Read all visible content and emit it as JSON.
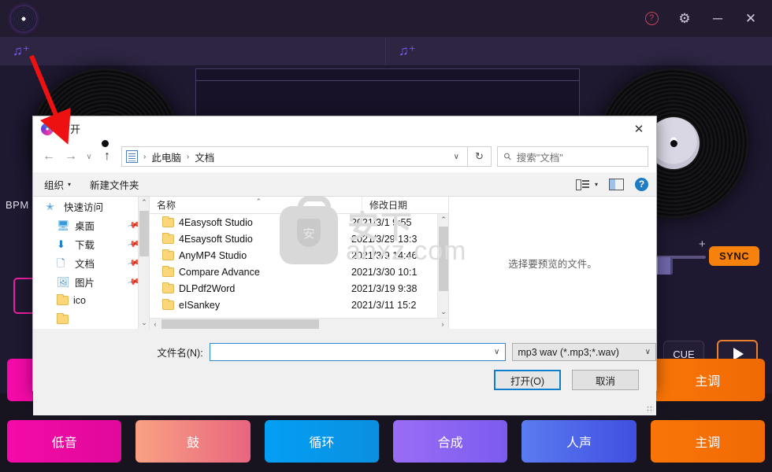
{
  "app": {
    "titlebar": {
      "logo_icon": "vinyl-record-logo",
      "buttons": [
        {
          "name": "help-button",
          "icon": "question-circle-icon",
          "label": "?"
        },
        {
          "name": "settings-button",
          "icon": "gear-icon",
          "label": "⚙"
        },
        {
          "name": "minimize-button",
          "icon": "minimize-icon",
          "label": "—"
        },
        {
          "name": "close-button",
          "icon": "close-icon",
          "label": "✕"
        }
      ]
    },
    "decks": {
      "left_add_icon": "music-note-plus-icon",
      "right_add_icon": "music-note-plus-icon",
      "bpm_label": "BPM",
      "sync_label": "SYNC",
      "cue_label": "CUE",
      "play_icon": "play-triangle-icon",
      "plus_mark": "+"
    },
    "pads": [
      {
        "label": "低音",
        "color": "#f40aa8"
      },
      {
        "label": "鼓",
        "color": "#f2806c"
      },
      {
        "label": "循环",
        "color": "#039ff4"
      },
      {
        "label": "合成",
        "color": "#9a6cf5"
      },
      {
        "label": "人声",
        "color": "#4a6ae8"
      },
      {
        "label": "主调",
        "color": "#f97507"
      }
    ]
  },
  "dialog": {
    "title": "打开",
    "title_icon": "app-vinyl-icon",
    "close_label": "✕",
    "nav": {
      "back_icon": "←",
      "forward_icon": "→",
      "recent_icon": "∨",
      "up_icon": "↑",
      "refresh_icon": "↻",
      "address_icon": "documents-folder-icon",
      "breadcrumbs": [
        "此电脑",
        "文档"
      ],
      "breadcrumb_separator": "›",
      "dropdown_caret": "∨"
    },
    "search": {
      "placeholder": "搜索\"文档\"",
      "icon": "search-icon"
    },
    "toolbar": {
      "organize_label": "组织",
      "organize_caret": "▾",
      "new_folder_label": "新建文件夹",
      "view_icon": "list-view-icon",
      "view_caret": "▾",
      "preview_pane_icon": "preview-pane-icon",
      "help_icon": "help-circle-icon",
      "help_label": "?"
    },
    "nav_pane": {
      "items": [
        {
          "label": "快速访问",
          "icon": "star-icon",
          "level": 1,
          "pinned": false
        },
        {
          "label": "桌面",
          "icon": "desktop-icon",
          "level": 2,
          "pinned": true
        },
        {
          "label": "下载",
          "icon": "download-icon",
          "level": 2,
          "pinned": true
        },
        {
          "label": "文档",
          "icon": "documents-icon",
          "level": 2,
          "pinned": true
        },
        {
          "label": "图片",
          "icon": "pictures-icon",
          "level": 2,
          "pinned": true
        },
        {
          "label": "ico",
          "icon": "folder-icon",
          "level": 2,
          "pinned": false
        }
      ],
      "scroll_up": "⌃",
      "scroll_down": "⌄"
    },
    "file_list": {
      "columns": [
        "名称",
        "修改日期"
      ],
      "sort_indicator": "⌃",
      "rows": [
        {
          "name": "4Easysoft Studio",
          "date": "2021/3/1 9:55"
        },
        {
          "name": "4Esaysoft Studio",
          "date": "2021/3/29 13:3"
        },
        {
          "name": "AnyMP4 Studio",
          "date": "2021/3/9 14:46"
        },
        {
          "name": "Compare Advance",
          "date": "2021/3/30 10:1"
        },
        {
          "name": "DLPdf2Word",
          "date": "2021/3/19 9:38"
        },
        {
          "name": "eISankey",
          "date": "2021/3/11 15:2"
        }
      ],
      "hscroll_left": "‹",
      "hscroll_right": "›"
    },
    "preview": {
      "message": "选择要预览的文件。"
    },
    "footer": {
      "filename_label": "文件名(N):",
      "filename_value": "",
      "filename_caret": "∨",
      "filetype_value": "mp3 wav (*.mp3;*.wav)",
      "filetype_caret": "∨",
      "open_label": "打开(O)",
      "cancel_label": "取消"
    }
  },
  "watermark": {
    "text_top": "安下",
    "text_bottom": "anxz.com",
    "shield_char": "安"
  },
  "annotation": {
    "arrow_color": "#ee1111",
    "arrow_name": "red-pointer-arrow"
  }
}
